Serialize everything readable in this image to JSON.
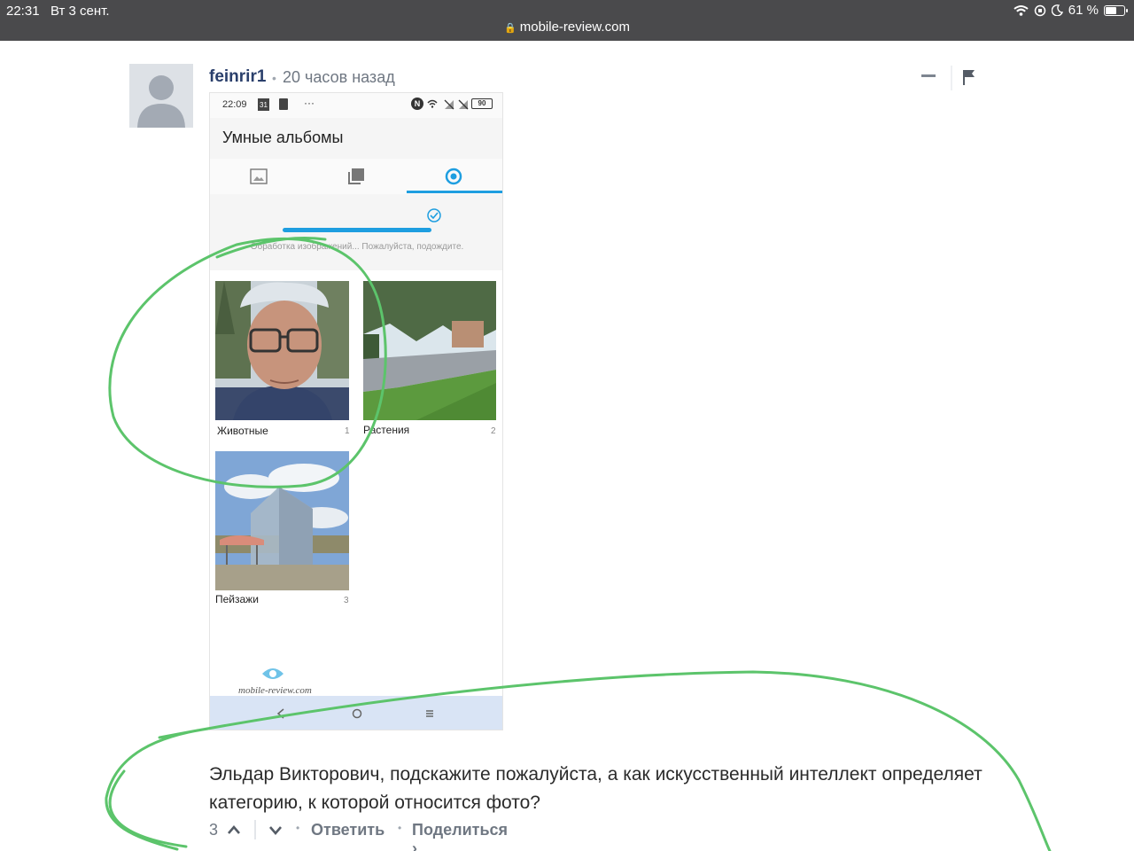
{
  "ipad_status": {
    "time": "22:31",
    "date": "Вт 3 сент.",
    "url": "mobile-review.com",
    "battery": "61 %",
    "battery_level": 0.61
  },
  "comment": {
    "author": "feinrir1",
    "timeago": "20 часов назад",
    "text": "Эльдар Викторович, подскажите пожалуйста, а как искусственный интеллект определяет категорию, к которой относится фото?",
    "votes": "3",
    "reply_label": "Ответить",
    "share_label": "Поделиться ›"
  },
  "phone": {
    "time": "22:09",
    "calendar_day": "31",
    "menu_dots": "···",
    "battery": "90",
    "title": "Умные альбомы",
    "processing": "Обработка изображений... Пожалуйста, подождите.",
    "albums": [
      {
        "label": "Животные",
        "count": "1"
      },
      {
        "label": "Растения",
        "count": "2"
      },
      {
        "label": "Пейзажи",
        "count": "3"
      }
    ],
    "watermark": "mobile-review.com"
  },
  "colors": {
    "annotation": "#5cc46b",
    "accent": "#1e9ee0",
    "author": "#2a3f6b"
  }
}
